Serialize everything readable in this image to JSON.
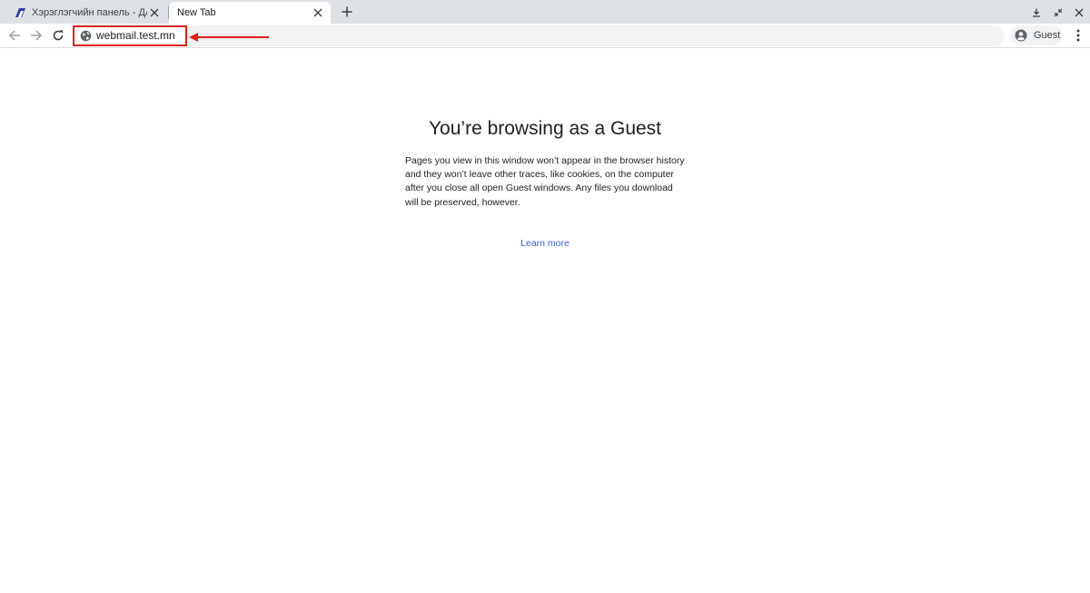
{
  "tabs": [
    {
      "title": "Хэрэглэгчийн панель - ДАТАК",
      "active": false
    },
    {
      "title": "New Tab",
      "active": true
    }
  ],
  "toolbar": {
    "url": "webmail.test.mn",
    "profile_label": "Guest"
  },
  "page": {
    "heading": "You’re browsing as a Guest",
    "description": "Pages you view in this window won’t appear in the browser history and they won’t leave other traces, like cookies, on the computer after you close all open Guest windows. Any files you download will be preserved, however.",
    "learn_more": "Learn more"
  },
  "icons": {
    "tab_favicon": "datacom-favicon-icon",
    "close": "close-icon",
    "new_tab": "plus-icon",
    "back": "arrow-back-icon",
    "forward": "arrow-forward-icon",
    "reload": "reload-icon",
    "site_info": "globe-icon",
    "profile": "user-circle-icon",
    "menu": "more-vert-icon"
  },
  "colors": {
    "annotation": "#e0201b",
    "link": "#3b5fd8",
    "tabstrip": "#dee1e6"
  }
}
